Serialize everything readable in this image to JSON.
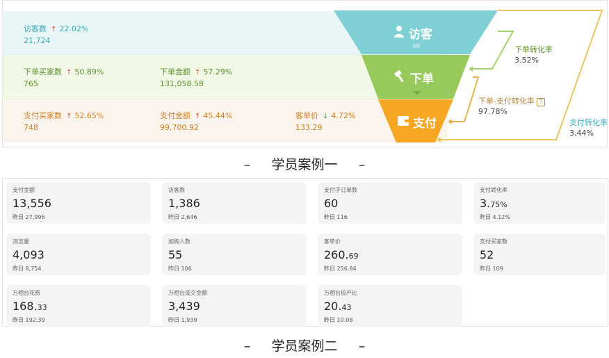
{
  "case1": {
    "rows": [
      {
        "metrics": [
          {
            "label": "访客数",
            "change": "22.02%",
            "dir": "up",
            "value": "21,724"
          }
        ]
      },
      {
        "metrics": [
          {
            "label": "下单买家数",
            "change": "50.89%",
            "dir": "up",
            "value": "765"
          },
          {
            "label": "下单金额",
            "change": "57.29%",
            "dir": "up",
            "value": "131,058.58"
          }
        ]
      },
      {
        "metrics": [
          {
            "label": "支付买家数",
            "change": "52.65%",
            "dir": "up",
            "value": "748"
          },
          {
            "label": "支付金额",
            "change": "45.44%",
            "dir": "up",
            "value": "99,700.92"
          },
          {
            "label": "客单价",
            "change": "4.72%",
            "dir": "down",
            "value": "133.29"
          }
        ]
      }
    ],
    "funnel": {
      "stages": [
        "访客",
        "下单",
        "支付"
      ],
      "colors": [
        "#7fd0d4",
        "#97c95c",
        "#f5a623"
      ]
    },
    "rates": [
      {
        "label": "下单转化率",
        "value": "3.52%"
      },
      {
        "label": "下单-支付转化率",
        "value": "97.78%"
      },
      {
        "label": "支付转化率",
        "value": "3.44%"
      }
    ],
    "caption": "–     学员案例一     –"
  },
  "case2": {
    "cards": [
      {
        "title": "支付金额",
        "value_int": "13,556",
        "value_dec": "",
        "yesterday": "昨日 27,996"
      },
      {
        "title": "访客数",
        "value_int": "1,386",
        "value_dec": "",
        "yesterday": "昨日 2,646"
      },
      {
        "title": "支付子订单数",
        "value_int": "60",
        "value_dec": "",
        "yesterday": "昨日 116"
      },
      {
        "title": "支付转化率",
        "value_int": "3.",
        "value_dec": "75%",
        "yesterday": "昨日 4.12%"
      },
      {
        "title": "浏览量",
        "value_int": "4,093",
        "value_dec": "",
        "yesterday": "昨日 8,754"
      },
      {
        "title": "加购人数",
        "value_int": "55",
        "value_dec": "",
        "yesterday": "昨日 106"
      },
      {
        "title": "客单价",
        "value_int": "260.",
        "value_dec": "69",
        "yesterday": "昨日 256.84"
      },
      {
        "title": "支付买家数",
        "value_int": "52",
        "value_dec": "",
        "yesterday": "昨日 109"
      },
      {
        "title": "万相台花费",
        "value_int": "168.",
        "value_dec": "33",
        "yesterday": "昨日 192.39"
      },
      {
        "title": "万相台成交金额",
        "value_int": "3,439",
        "value_dec": "",
        "yesterday": "昨日 1,939"
      },
      {
        "title": "万相台投产比",
        "value_int": "20.",
        "value_dec": "43",
        "yesterday": "昨日 10.08"
      }
    ],
    "caption": "–     学员案例二     –"
  }
}
